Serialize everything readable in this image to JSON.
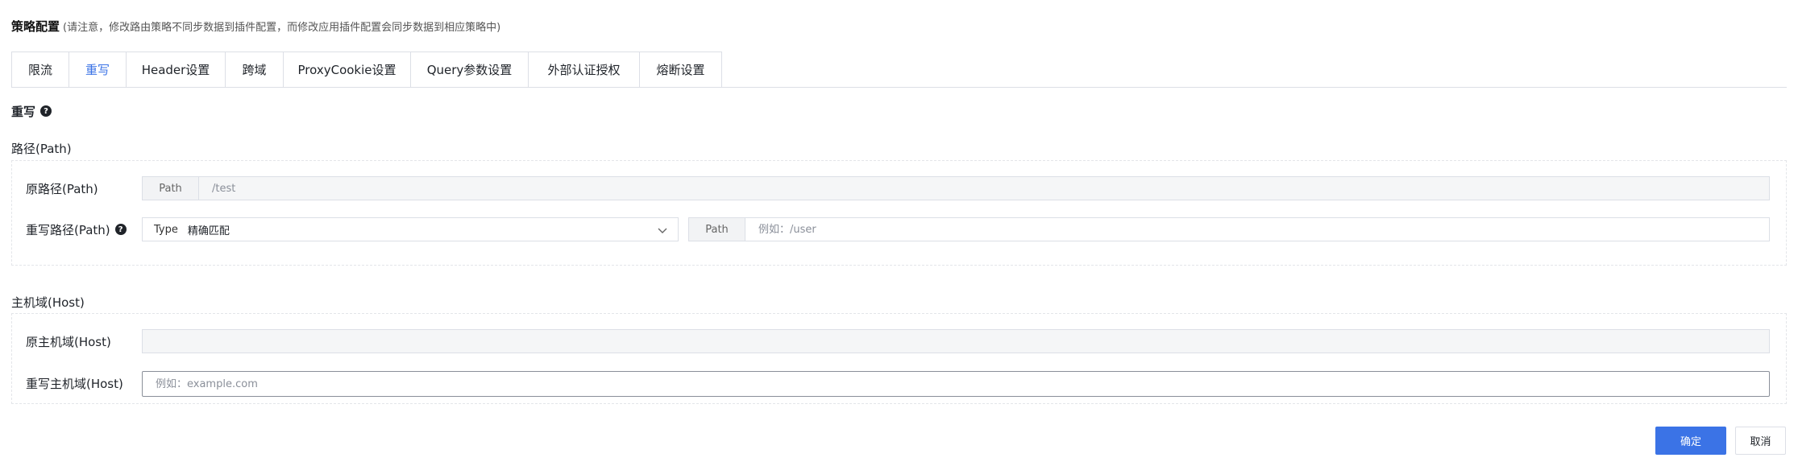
{
  "header": {
    "title": "策略配置",
    "note": "(请注意，修改路由策略不同步数据到插件配置，而修改应用插件配置会同步数据到相应策略中)"
  },
  "tabs": [
    {
      "label": "限流",
      "active": false
    },
    {
      "label": "重写",
      "active": true
    },
    {
      "label": "Header设置",
      "active": false
    },
    {
      "label": "跨域",
      "active": false
    },
    {
      "label": "ProxyCookie设置",
      "active": false
    },
    {
      "label": "Query参数设置",
      "active": false
    },
    {
      "label": "外部认证授权",
      "active": false
    },
    {
      "label": "熔断设置",
      "active": false
    }
  ],
  "rewrite": {
    "title": "重写",
    "path_section": {
      "title": "路径(Path)",
      "original": {
        "label": "原路径(Path)",
        "addon": "Path",
        "value": "/test"
      },
      "rewrite": {
        "label": "重写路径(Path)",
        "type_prefix": "Type",
        "type_value": "精确匹配",
        "addon": "Path",
        "placeholder": "例如：/user"
      }
    },
    "host_section": {
      "title": "主机域(Host)",
      "original": {
        "label": "原主机域(Host)",
        "value": ""
      },
      "rewrite": {
        "label": "重写主机域(Host)",
        "placeholder": "例如：example.com"
      }
    }
  },
  "footer": {
    "confirm_label": "确定",
    "cancel_label": "取消"
  },
  "colors": {
    "accent": "#3b73e6",
    "border": "#dcdfe6",
    "disabled_bg": "#f5f6f7"
  },
  "icons": {
    "help": "question-circle-icon",
    "chevron": "chevron-down-icon"
  }
}
